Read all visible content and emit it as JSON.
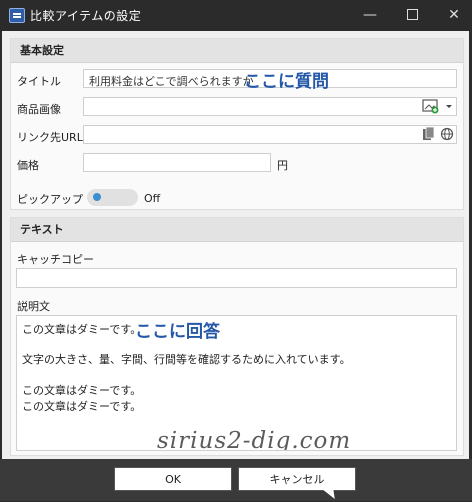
{
  "window": {
    "title": "比較アイテムの設定"
  },
  "section_basic": {
    "header": "基本設定",
    "title_label": "タイトル",
    "title_value": "利用料金はどこで調べられますか",
    "title_overlay": "ここに質問",
    "image_label": "商品画像",
    "image_value": "",
    "link_label": "リンク先URL",
    "link_value": "",
    "price_label": "価格",
    "price_value": "",
    "price_unit": "円",
    "pickup_label": "ピックアップ",
    "pickup_state": "Off"
  },
  "section_text": {
    "header": "テキスト",
    "catch_label": "キャッチコピー",
    "catch_value": "",
    "desc_label": "説明文",
    "desc_overlay": "ここに回答",
    "desc_lines": [
      "この文章はダミーです。",
      "",
      "文字の大きさ、量、字間、行間等を確認するために入れています。",
      "",
      "この文章はダミーです。",
      "この文章はダミーです。"
    ]
  },
  "watermark": "sirius2-dig.com",
  "buttons": {
    "ok": "OK",
    "cancel": "キャンセル"
  },
  "icons": [
    "app-icon",
    "minimize-icon",
    "maximize-icon",
    "close-icon",
    "image-add-icon",
    "file-icon",
    "globe-icon",
    "chevron-down-icon"
  ]
}
